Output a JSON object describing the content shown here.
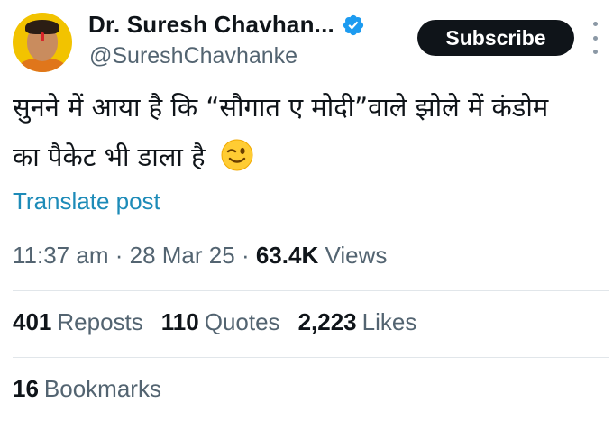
{
  "author": {
    "name": "Dr. Suresh Chavhan...",
    "handle": "@SureshChavhanke",
    "verified_color": "#1d9bf0"
  },
  "header": {
    "subscribe_label": "Subscribe",
    "more_icon": "more-vertical-icon"
  },
  "post": {
    "lines": [
      "सुनने में आया है कि “सौगात ए मोदी”वाले झोले में कंडोम",
      "का पैकेट भी डाला है"
    ],
    "emoji": "winking-face-icon",
    "translate_label": "Translate post"
  },
  "meta": {
    "time": "11:37 am",
    "separator": "·",
    "date": "28 Mar 25",
    "views_count": "63.4K",
    "views_label": "Views"
  },
  "stats": {
    "reposts_count": "401",
    "reposts_label": "Reposts",
    "quotes_count": "110",
    "quotes_label": "Quotes",
    "likes_count": "2,223",
    "likes_label": "Likes",
    "bookmarks_count": "16",
    "bookmarks_label": "Bookmarks"
  },
  "colors": {
    "link": "#1d8bb8",
    "secondary_text": "#536471",
    "primary_text": "#0f1419",
    "button_bg": "#0f1419"
  }
}
